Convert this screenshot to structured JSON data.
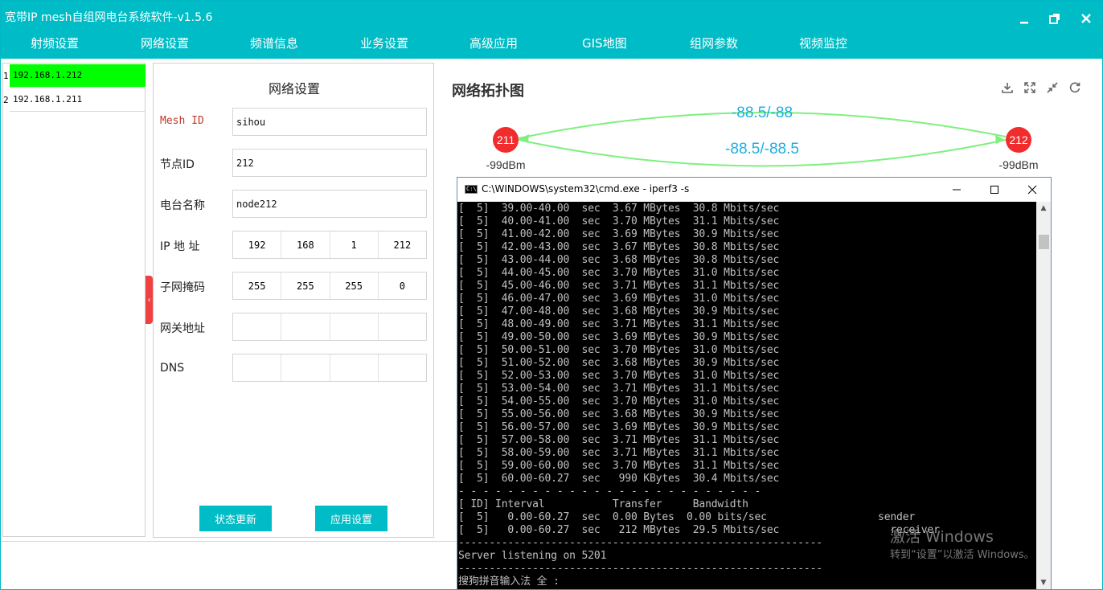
{
  "app": {
    "title": "宽带IP mesh自组网电台系统软件-v1.5.6",
    "brand_color": "#00bcc6"
  },
  "menu": [
    "射频设置",
    "网络设置",
    "频谱信息",
    "业务设置",
    "高级应用",
    "GIS地图",
    "组网参数",
    "视频监控"
  ],
  "window_controls": [
    "minimize-icon",
    "restore-icon",
    "close-icon"
  ],
  "node_list": {
    "items": [
      {
        "index": "1",
        "ip": "192.168.1.212",
        "selected": true
      },
      {
        "index": "2",
        "ip": "192.168.1.211",
        "selected": false
      }
    ],
    "selected_color": "#00ff00"
  },
  "settings": {
    "title": "网络设置",
    "mesh_id_label": "Mesh ID",
    "mesh_id_value": "sihou",
    "node_id_label": "节点ID",
    "node_id_value": "212",
    "radio_name_label": "电台名称",
    "radio_name_value": "node212",
    "ip_label": "IP 地 址",
    "ip": [
      "192",
      "168",
      "1",
      "212"
    ],
    "mask_label": "子网掩码",
    "mask": [
      "255",
      "255",
      "255",
      "0"
    ],
    "gateway_label": "网关地址",
    "gateway": [
      "",
      "",
      "",
      ""
    ],
    "dns_label": "DNS",
    "dns": [
      "",
      "",
      "",
      ""
    ],
    "btn_refresh": "状态更新",
    "btn_apply": "应用设置"
  },
  "topology": {
    "title": "网络拓扑图",
    "tools": [
      "download-icon",
      "fullscreen-icon",
      "shrink-icon",
      "refresh-icon"
    ],
    "nodes": [
      {
        "id": "211",
        "signal": "-99dBm"
      },
      {
        "id": "212",
        "signal": "-99dBm"
      }
    ],
    "links": [
      {
        "label": "-88.5/-88"
      },
      {
        "label": "-88.5/-88.5"
      }
    ],
    "node_color": "#f02c2c",
    "link_color": "#7ef07e",
    "label_color": "#1eaee0"
  },
  "cmd": {
    "title": "C:\\WINDOWS\\system32\\cmd.exe - iperf3  -s",
    "lines": [
      "[  5]  39.00-40.00  sec  3.67 MBytes  30.8 Mbits/sec",
      "[  5]  40.00-41.00  sec  3.70 MBytes  31.1 Mbits/sec",
      "[  5]  41.00-42.00  sec  3.69 MBytes  30.9 Mbits/sec",
      "[  5]  42.00-43.00  sec  3.67 MBytes  30.8 Mbits/sec",
      "[  5]  43.00-44.00  sec  3.68 MBytes  30.8 Mbits/sec",
      "[  5]  44.00-45.00  sec  3.70 MBytes  31.0 Mbits/sec",
      "[  5]  45.00-46.00  sec  3.71 MBytes  31.1 Mbits/sec",
      "[  5]  46.00-47.00  sec  3.69 MBytes  31.0 Mbits/sec",
      "[  5]  47.00-48.00  sec  3.68 MBytes  30.9 Mbits/sec",
      "[  5]  48.00-49.00  sec  3.71 MBytes  31.1 Mbits/sec",
      "[  5]  49.00-50.00  sec  3.69 MBytes  30.9 Mbits/sec",
      "[  5]  50.00-51.00  sec  3.70 MBytes  31.0 Mbits/sec",
      "[  5]  51.00-52.00  sec  3.68 MBytes  30.9 Mbits/sec",
      "[  5]  52.00-53.00  sec  3.70 MBytes  31.0 Mbits/sec",
      "[  5]  53.00-54.00  sec  3.71 MBytes  31.1 Mbits/sec",
      "[  5]  54.00-55.00  sec  3.70 MBytes  31.0 Mbits/sec",
      "[  5]  55.00-56.00  sec  3.68 MBytes  30.9 Mbits/sec",
      "[  5]  56.00-57.00  sec  3.69 MBytes  30.9 Mbits/sec",
      "[  5]  57.00-58.00  sec  3.71 MBytes  31.1 Mbits/sec",
      "[  5]  58.00-59.00  sec  3.71 MBytes  31.1 Mbits/sec",
      "[  5]  59.00-60.00  sec  3.70 MBytes  31.1 Mbits/sec",
      "[  5]  60.00-60.27  sec   990 KBytes  30.4 Mbits/sec",
      "- - - - - - - - - - - - - - - - - - - - - - - - -",
      "[ ID] Interval           Transfer     Bandwidth",
      "[  5]   0.00-60.27  sec  0.00 Bytes  0.00 bits/sec                  sender",
      "[  5]   0.00-60.27  sec   212 MBytes  29.5 Mbits/sec                  receiver",
      "-----------------------------------------------------------",
      "Server listening on 5201",
      "-----------------------------------------------------------",
      "搜狗拼音输入法 全 :"
    ]
  },
  "watermark": {
    "line1": "激活 Windows",
    "line2": "转到“设置”以激活 Windows。"
  }
}
